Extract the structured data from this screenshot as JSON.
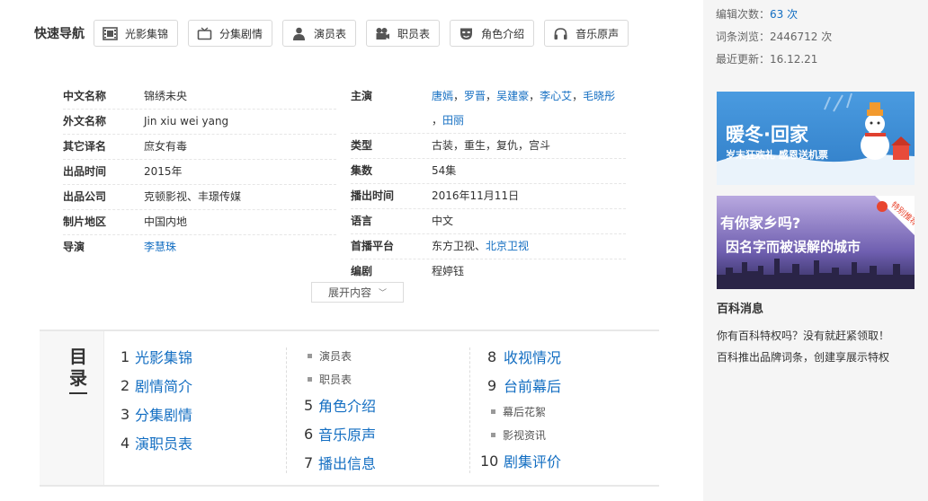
{
  "quick_nav": {
    "title": "快速导航",
    "buttons": [
      {
        "label": "光影集锦",
        "icon": "film-strip-icon"
      },
      {
        "label": "分集剧情",
        "icon": "tv-icon"
      },
      {
        "label": "演员表",
        "icon": "person-icon"
      },
      {
        "label": "职员表",
        "icon": "movie-camera-icon"
      },
      {
        "label": "角色介绍",
        "icon": "mask-icon"
      },
      {
        "label": "音乐原声",
        "icon": "headphones-icon"
      }
    ]
  },
  "info_left": [
    {
      "key": "中文名称",
      "value": "锦绣未央"
    },
    {
      "key": "外文名称",
      "value": "Jin xiu wei yang"
    },
    {
      "key": "其它译名",
      "value": "庶女有毒"
    },
    {
      "key": "出品时间",
      "value": "2015年"
    },
    {
      "key": "出品公司",
      "value": "克顿影视、丰璟传媒"
    },
    {
      "key": "制片地区",
      "value": "中国内地"
    },
    {
      "key": "导演",
      "value": "李慧珠"
    }
  ],
  "info_right": {
    "cast_key": "主演",
    "cast": [
      "唐嫣",
      "罗晋",
      "吴建豪",
      "李心艾",
      "毛晓彤",
      "田丽"
    ],
    "cast_sep": "，",
    "rows": [
      {
        "key": "类型",
        "value": "古装，重生，复仇，宫斗"
      },
      {
        "key": "集数",
        "value": "54集"
      },
      {
        "key": "播出时间",
        "value": "2016年11月11日"
      },
      {
        "key": "语言",
        "value": "中文"
      }
    ],
    "platform_key": "首播平台",
    "platform_a": "东方卫视",
    "platform_sep": "、",
    "platform_b": "北京卫视",
    "writer_key": "编剧",
    "writer": "程婷钰"
  },
  "expand": {
    "label": "展开内容",
    "chevron": "﹀"
  },
  "catalog": {
    "title_a": "目",
    "title_b": "录",
    "col1": [
      {
        "num": "1",
        "label": "光影集锦"
      },
      {
        "num": "2",
        "label": "剧情简介"
      },
      {
        "num": "3",
        "label": "分集剧情"
      },
      {
        "num": "4",
        "label": "演职员表"
      }
    ],
    "col2_subs": [
      "演员表",
      "职员表"
    ],
    "col2": [
      {
        "num": "5",
        "label": "角色介绍"
      },
      {
        "num": "6",
        "label": "音乐原声"
      },
      {
        "num": "7",
        "label": "播出信息"
      }
    ],
    "col3_top": [
      {
        "num": "8",
        "label": "收视情况"
      },
      {
        "num": "9",
        "label": "台前幕后"
      }
    ],
    "col3_subs": [
      "幕后花絮",
      "影视资讯"
    ],
    "col3_bottom": [
      {
        "num": "10",
        "label": "剧集评价"
      }
    ]
  },
  "sidebar": {
    "edit_label": "编辑次数：",
    "edit_count": "63",
    "edit_unit": "次",
    "views": "词条浏览：2446712 次",
    "updated": "最近更新：16.12.21",
    "banner1": {
      "title": "暖冬·回家",
      "sub": "岁末狂欢礼 感恩送机票"
    },
    "banner2": {
      "line1": "有你家乡吗?",
      "line2": "因名字而被误解的城市",
      "tag": "特别推荐"
    },
    "news_title": "百科消息",
    "news1": "你有百科特权吗？没有就赶紧领取！",
    "news2": "百科推出品牌词条，创建享展示特权"
  },
  "colors": {
    "link": "#136ec2",
    "banner1_bg": "#3b8fd4",
    "banner2_bg": "#6b5aa8"
  }
}
